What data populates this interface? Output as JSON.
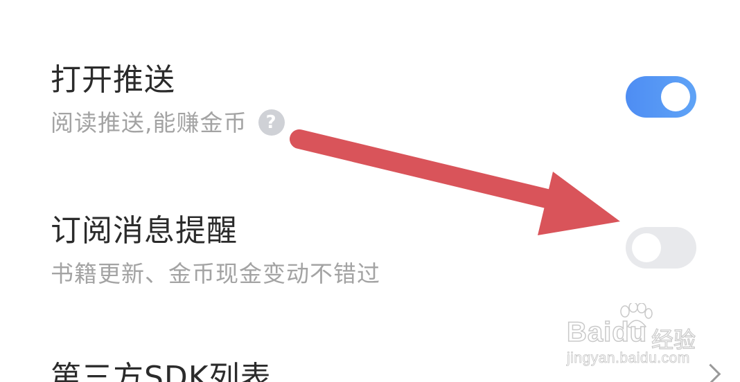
{
  "settings": {
    "push": {
      "title": "打开推送",
      "subtitle": "阅读推送,能赚金币",
      "help_icon": "?",
      "enabled": true
    },
    "subscription": {
      "title": "订阅消息提醒",
      "subtitle": "书籍更新、金币现金变动不错过",
      "enabled": false
    },
    "sdk_list": {
      "title": "第三方SDK列表"
    }
  },
  "watermark": {
    "brand": "Baidu",
    "product": "经验",
    "url": "jingyan.baidu.com"
  },
  "colors": {
    "toggle_on": "#4e8df3",
    "toggle_off": "#e8e9ec",
    "annotation_arrow": "#d9545a",
    "title_text": "#2b2b2b",
    "subtitle_text": "#a3a3a3"
  },
  "icons": {
    "help": "question-circle-icon",
    "chevron": "chevron-right-icon"
  }
}
